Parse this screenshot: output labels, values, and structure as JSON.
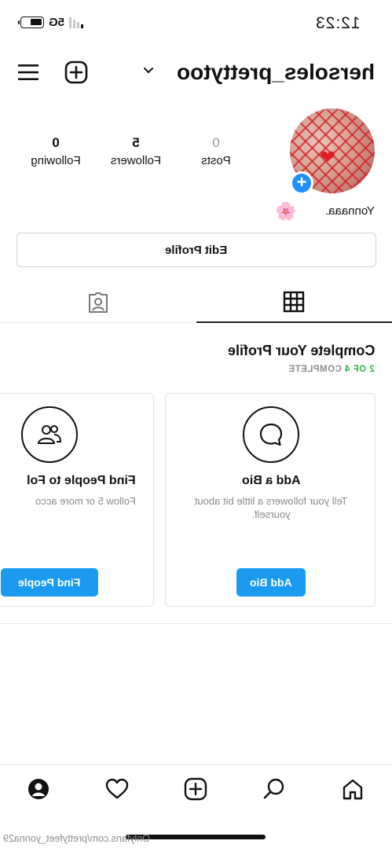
{
  "status_bar": {
    "time": "12:23",
    "network": "5G"
  },
  "header": {
    "username": "hersoles_prettytoo",
    "menu_icon": "hamburger-icon",
    "add_icon": "plus-square-icon",
    "chevron_icon": "chevron-down-icon"
  },
  "profile": {
    "display_name": "Yonnaaa.",
    "flower_emoji": "🌸",
    "stats": [
      {
        "value": "0",
        "label": "Posts"
      },
      {
        "value": "5",
        "label": "Followers"
      },
      {
        "value": "0",
        "label": "Following"
      }
    ],
    "edit_label": "Edit Profile"
  },
  "tabs": [
    {
      "icon": "grid-icon",
      "active": true
    },
    {
      "icon": "tagged-person-icon",
      "active": false
    }
  ],
  "complete_profile": {
    "title": "Complete Your Profile",
    "progress_done": "2 OF 4",
    "progress_label": "COMPLETE",
    "cards": [
      {
        "icon": "speech-bubble-icon",
        "title": "Add a Bio",
        "desc": "Tell your followers a little bit about yourself.",
        "button": "Add Bio"
      },
      {
        "icon": "people-icon",
        "title": "Find People to Fol",
        "desc": "Follow 5 or more acco",
        "button": "Find People"
      }
    ]
  },
  "bottom_nav": [
    "home-icon",
    "search-icon",
    "plus-square-icon",
    "heart-icon",
    "profile-icon"
  ],
  "watermark": "Onlyfans.com/prettyfeet_yonna29",
  "colors": {
    "accent_blue": "#1a9bf0",
    "complete_green": "#2fb34a",
    "muted_gray": "#8e8e8e"
  }
}
